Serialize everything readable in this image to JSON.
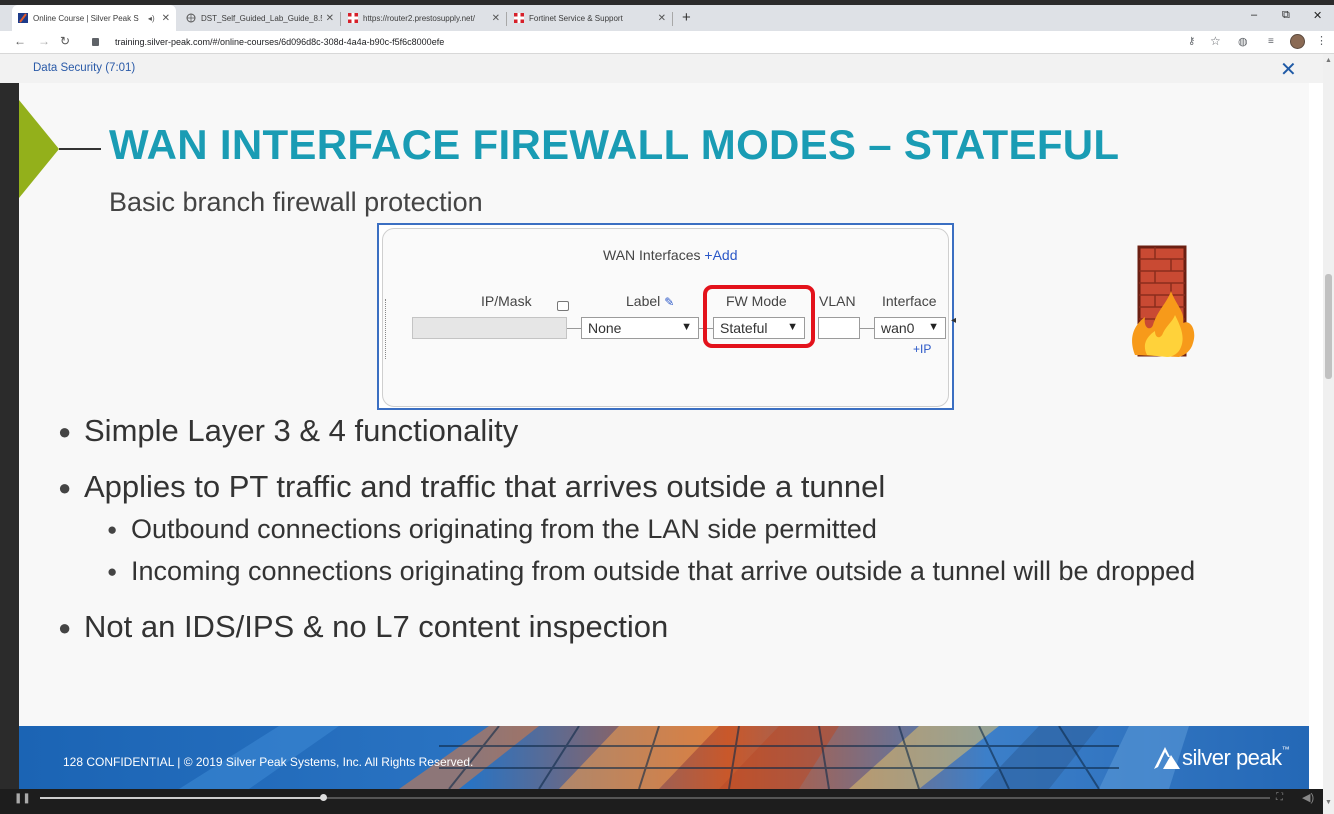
{
  "browser": {
    "tabs": [
      {
        "label": "Online Course | Silver Peak S",
        "icon": "silverpeak-favicon",
        "active": true
      },
      {
        "label": "DST_Self_Guided_Lab_Guide_8.5",
        "icon": "globe-icon",
        "active": false
      },
      {
        "label": "https://router2.prestosupply.net/",
        "icon": "fortinet-favicon",
        "active": false
      },
      {
        "label": "Fortinet Service & Support",
        "icon": "fortinet-favicon",
        "active": false
      }
    ],
    "new_tab": "+",
    "window_controls": {
      "minimize": "–",
      "restore": "⧉",
      "close": "✕"
    },
    "url": "training.silver-peak.com/#/online-courses/6d096d8c-308d-4a4a-b90c-f5f6c8000efe",
    "nav": {
      "back": "←",
      "forward": "→",
      "reload": "↻"
    }
  },
  "course": {
    "title": "Data Security (7:01)",
    "close": "✕"
  },
  "slide": {
    "title": "WAN INTERFACE FIREWALL MODES – STATEFUL",
    "subtitle": "Basic branch firewall protection",
    "panel": {
      "header": "WAN Interfaces",
      "add": "+Add",
      "columns": {
        "ip_mask": "IP/Mask",
        "label": "Label",
        "fw_mode": "FW Mode",
        "vlan": "VLAN",
        "interface": "Interface"
      },
      "label_value": "None",
      "fw_mode_value": "Stateful",
      "interface_value": "wan0",
      "add_ip": "+IP"
    },
    "bullets": [
      {
        "text": "Simple Layer 3 & 4 functionality",
        "level": 1
      },
      {
        "text": "Applies to PT traffic and traffic that arrives outside a tunnel",
        "level": 1
      },
      {
        "text": "Outbound connections originating from the LAN side permitted",
        "level": 2
      },
      {
        "text": "Incoming connections originating from outside that arrive outside a tunnel will be dropped",
        "level": 2
      },
      {
        "text": "Not an IDS/IPS & no L7 content inspection",
        "level": 1
      }
    ],
    "footer_text": "128 CONFIDENTIAL | © 2019 Silver Peak Systems, Inc. All Rights Reserved.",
    "logo_text": "silver peak",
    "logo_tm": "™"
  },
  "player": {
    "progress": 0.23
  },
  "colors": {
    "title": "#1a9cb4",
    "accent_green": "#93b01b",
    "highlight_red": "#e3121b",
    "link_blue": "#2a57c7"
  }
}
